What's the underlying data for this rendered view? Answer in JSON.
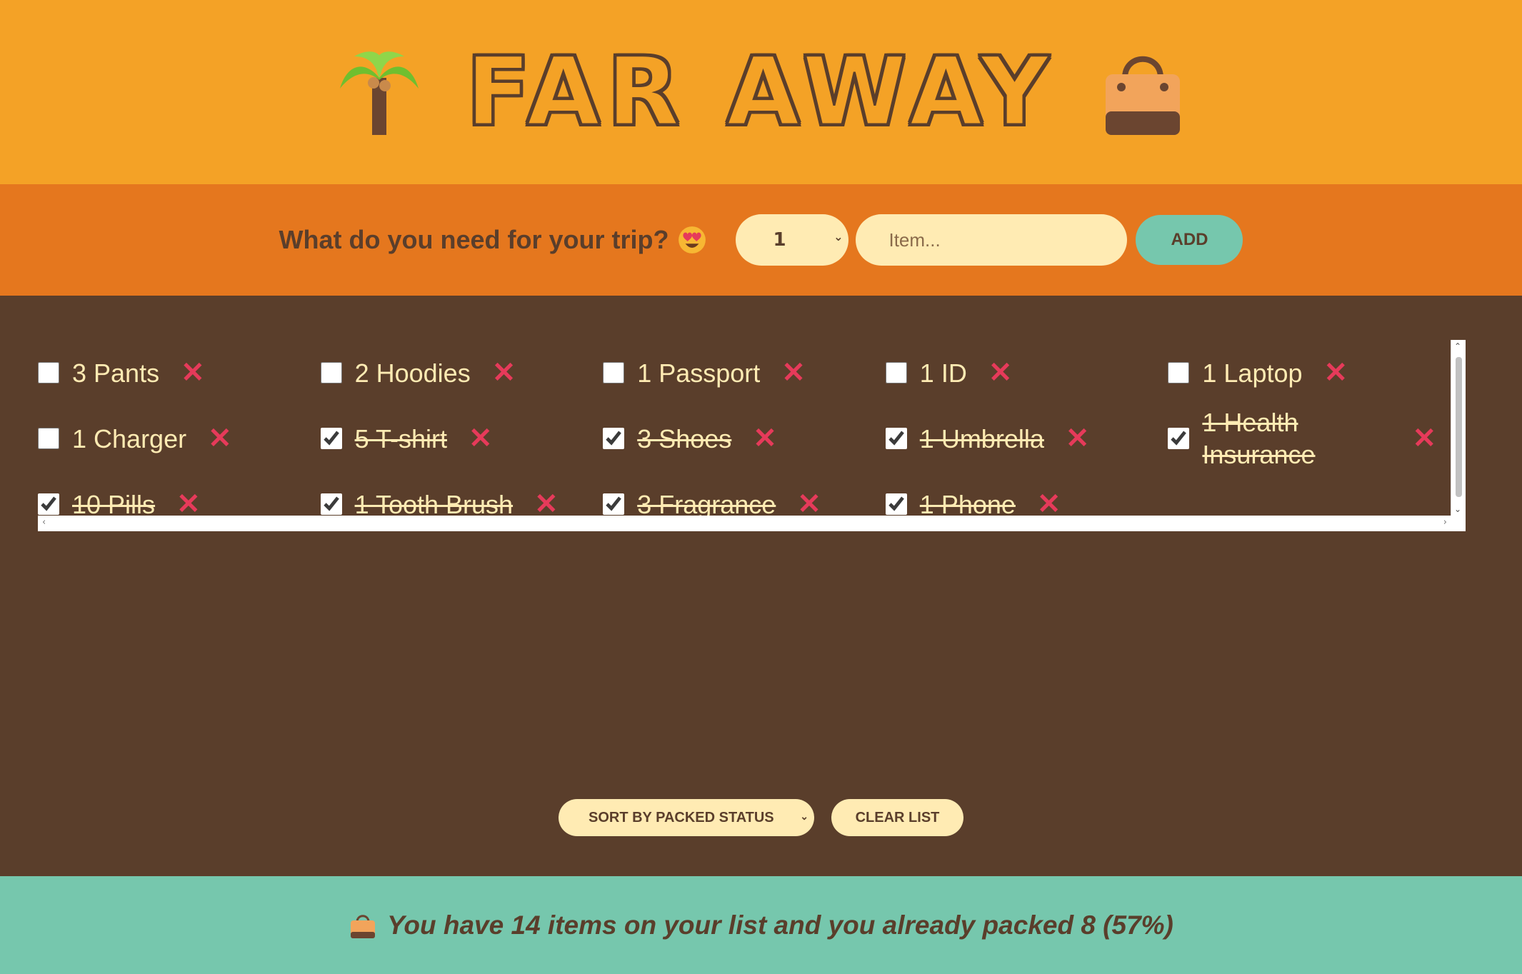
{
  "header": {
    "title": "FAR AWAY",
    "left_icon": "palm-tree-icon",
    "right_icon": "handbag-icon"
  },
  "form": {
    "question": "What do you need for your trip?",
    "question_icon": "heart-eyes-emoji-icon",
    "quantity_selected": "1",
    "item_placeholder": "Item...",
    "add_label": "ADD"
  },
  "items": [
    {
      "label": "3 Pants",
      "packed": false
    },
    {
      "label": "2 Hoodies",
      "packed": false
    },
    {
      "label": "1 Passport",
      "packed": false
    },
    {
      "label": "1 ID",
      "packed": false
    },
    {
      "label": "1 Laptop",
      "packed": false
    },
    {
      "label": "1 Charger",
      "packed": false
    },
    {
      "label": "5 T-shirt",
      "packed": true
    },
    {
      "label": "3 Shoes",
      "packed": true
    },
    {
      "label": "1 Umbrella",
      "packed": true
    },
    {
      "label": "1 Health Insurance",
      "packed": true
    },
    {
      "label": "10 Pills",
      "packed": true
    },
    {
      "label": "1 Tooth Brush",
      "packed": true
    },
    {
      "label": "3 Fragrance",
      "packed": true
    },
    {
      "label": "1 Phone",
      "packed": true
    }
  ],
  "remove_icon": "x-icon",
  "actions": {
    "sort_selected": "SORT BY PACKED STATUS",
    "clear_label": "CLEAR LIST"
  },
  "footer": {
    "stats": "You have 14 items on your list and you already packed 8 (57%)"
  },
  "colors": {
    "header_bg": "#f4a226",
    "form_bg": "#e5771e",
    "list_bg": "#5a3e2b",
    "footer_bg": "#76c7ad",
    "cream": "#ffebb3",
    "remove_red": "#e63a5a"
  }
}
